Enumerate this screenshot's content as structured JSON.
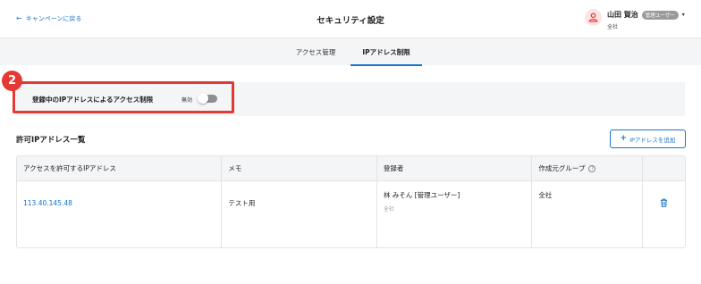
{
  "header": {
    "back_label": "キャンペーンに戻る",
    "title": "セキュリティ設定",
    "user": {
      "name": "山田 賀治",
      "role": "管理ユーザー",
      "org": "全社"
    }
  },
  "tabs": [
    {
      "label": "アクセス管理",
      "active": false
    },
    {
      "label": "IPアドレス制限",
      "active": true
    }
  ],
  "step_number": "2",
  "restriction": {
    "label": "登録中のIPアドレスによるアクセス制限",
    "status": "無効",
    "enabled": false
  },
  "section": {
    "title": "許可IPアドレス一覧",
    "add_button": "IPアドレスを追加"
  },
  "table": {
    "headers": [
      "アクセスを許可するIPアドレス",
      "メモ",
      "登録者",
      "作成元グループ"
    ],
    "rows": [
      {
        "ip": "113.40.145.48",
        "memo": "テスト用",
        "registrant": "林 みそん [管理ユーザー]",
        "registrant_org": "全社",
        "group": "全社"
      }
    ]
  },
  "colors": {
    "accent": "#1a73c9",
    "highlight": "#e53935",
    "panel_bg": "#f4f5f6"
  }
}
